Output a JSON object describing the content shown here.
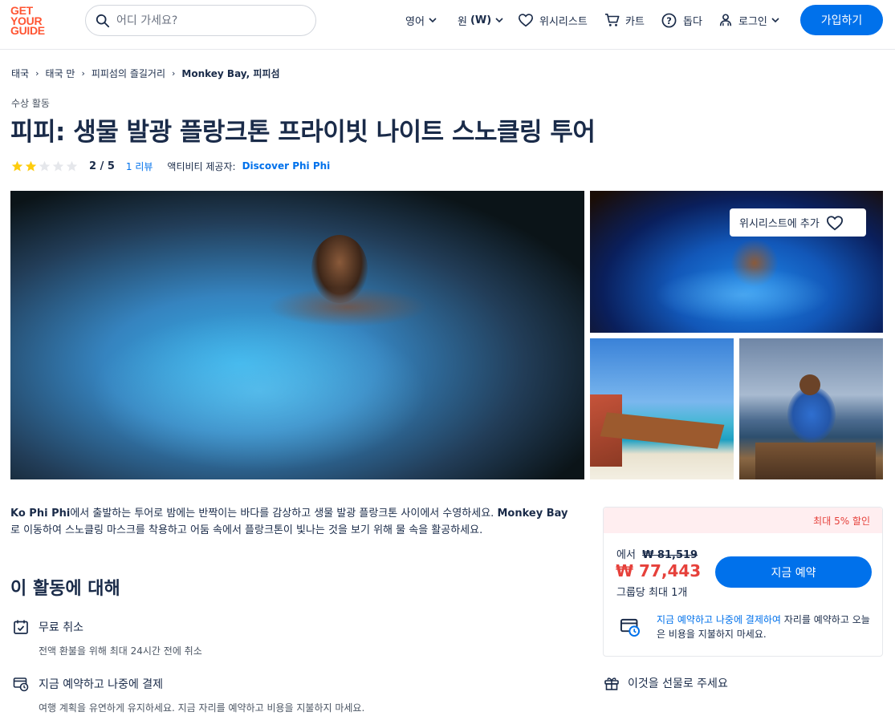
{
  "header": {
    "logo_lines": [
      "GET",
      "YOUR",
      "GUIDE"
    ],
    "search_placeholder": "어디 가세요?",
    "language": "영어",
    "currency": "원",
    "currency_symbol": "(W)",
    "wishlist": "위시리스트",
    "cart": "카트",
    "help": "돕다",
    "login": "로그인",
    "signup": "가입하기"
  },
  "breadcrumb": [
    "태국",
    "태국 만",
    "피피섬의 즐길거리",
    "Monkey Bay, 피피섬"
  ],
  "category": "수상 활동",
  "title": "피피: 생물 발광 플랑크톤 프라이빗 나이트 스노클링 투어",
  "rating": {
    "value": 2,
    "max": 5,
    "text": "2 / 5",
    "reviews": "1 리뷰",
    "provider_label": "액티비티 제공자:",
    "provider": "Discover Phi Phi"
  },
  "gallery": {
    "wishlist_add": "위시리스트에 추가"
  },
  "description": {
    "part1": "Ko Phi Phi",
    "part2": "에서 출발하는 투어로 밤에는 반짝이는 바다를 감상하고 생물 발광 플랑크톤 사이에서 수영하세요.",
    "part3": "Monkey Bay",
    "part4": "로 이동하여 스노클링 마스크를 착용하고 어둠 속에서 플랑크톤이 빛나는 것을 보기 위해 물 속을 활공하세요."
  },
  "about": {
    "title": "이 활동에 대해",
    "features": [
      {
        "name": "무료 취소",
        "desc": "전액 환불을 위해 최대 24시간 전에 취소",
        "icon": "calendar-check-icon"
      },
      {
        "name": "지금 예약하고 나중에 결제",
        "desc": "여행 계획을 유연하게 유지하세요. 지금 자리를 예약하고 비용을 지불하지 마세요.",
        "icon": "card-clock-icon"
      }
    ]
  },
  "booking": {
    "discount": "최대 5% 할인",
    "from_label": "에서",
    "old_price": "₩ 81,519",
    "price": "₩ 77,443",
    "per": "그룹당 최대 1개",
    "book_button": "지금 예약",
    "note_link": "지금 예약하고 나중에 결제하여",
    "note_text": " 자리를 예약하고 오늘은 비용을 지불하지 마세요."
  },
  "gift": "이것을 선물로 주세요",
  "colors": {
    "brand": "#ff5533",
    "primary": "#0071eb",
    "discount_red": "#e6413b",
    "star": "#fdcc0d"
  }
}
